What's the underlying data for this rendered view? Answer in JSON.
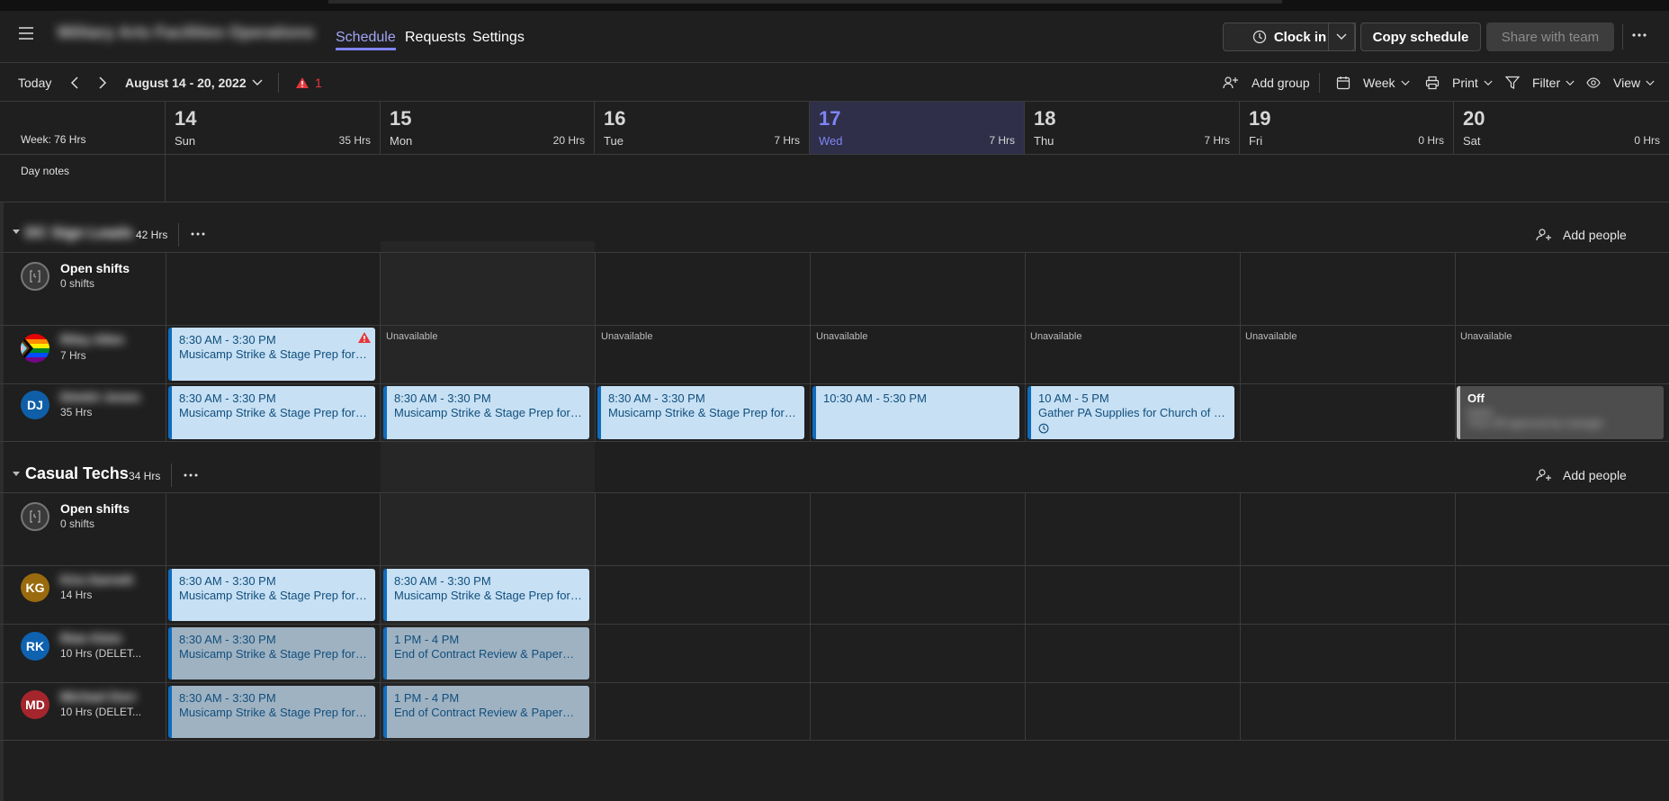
{
  "header": {
    "team_name": "Military Arts Facilities Operations",
    "tabs": [
      "Schedule",
      "Requests",
      "Settings"
    ],
    "clock_in_label": "Clock in",
    "copy_schedule_label": "Copy schedule",
    "share_label": "Share with team"
  },
  "toolbar": {
    "today_label": "Today",
    "date_range": "August 14 - 20, 2022",
    "alert_count": "1",
    "add_group_label": "Add group",
    "week_label": "Week",
    "print_label": "Print",
    "filter_label": "Filter",
    "view_label": "View"
  },
  "grid": {
    "week_label": "Week: 76 Hrs",
    "day_notes_label": "Day notes",
    "days": [
      {
        "num": "14",
        "name": "Sun",
        "hrs": "35 Hrs"
      },
      {
        "num": "15",
        "name": "Mon",
        "hrs": "20 Hrs"
      },
      {
        "num": "16",
        "name": "Tue",
        "hrs": "7 Hrs"
      },
      {
        "num": "17",
        "name": "Wed",
        "hrs": "7 Hrs"
      },
      {
        "num": "18",
        "name": "Thu",
        "hrs": "7 Hrs"
      },
      {
        "num": "19",
        "name": "Fri",
        "hrs": "0 Hrs"
      },
      {
        "num": "20",
        "name": "Sat",
        "hrs": "0 Hrs"
      }
    ]
  },
  "groups": [
    {
      "name": "DC Sign Leads",
      "hrs": "42 Hrs",
      "add_people_label": "Add people",
      "open_shifts_label": "Open shifts",
      "open_shifts_count": "0 shifts",
      "members": [
        {
          "name": "Riley Allen",
          "hrs": "7 Hrs"
        },
        {
          "initials": "DJ",
          "name": "Dimitri Jones",
          "hrs": "35 Hrs"
        }
      ]
    },
    {
      "name": "Casual Techs",
      "hrs": "34 Hrs",
      "add_people_label": "Add people",
      "open_shifts_label": "Open shifts",
      "open_shifts_count": "0 shifts",
      "members": [
        {
          "initials": "KG",
          "name": "Kira Garnett",
          "hrs": "14 Hrs"
        },
        {
          "initials": "RK",
          "name": "Rian Klein",
          "hrs": "10 Hrs (DELET..."
        },
        {
          "initials": "MD",
          "name": "Michael Dorr",
          "hrs": "10 Hrs (DELET..."
        }
      ]
    }
  ],
  "shifts": {
    "musicamp_time": "8:30 AM - 3:30 PM",
    "musicamp_title": "Musicamp Strike & Stage Prep for Ren...",
    "unavailable": "Unavailable",
    "wed_time": "10:30 AM - 5:30 PM",
    "thu_time": "10 AM - 5 PM",
    "thu_title": "Gather PA Supplies for Church of Chri...",
    "off_label": "Off",
    "off_sub1": "Notes",
    "off_sub2": "Time Off approved by manager",
    "contract_time": "1 PM - 4 PM",
    "contract_title": "End of Contract Review & Paperwork"
  },
  "colors": {
    "accent": "#7f85f5",
    "shift_bg": "#c7e0f4",
    "shift_border": "#0f6cbd",
    "alert": "#e5383b",
    "dj": "#0f6cbd",
    "kg": "#9a6a0e",
    "rk": "#0e62b0",
    "md": "#a4262c"
  }
}
